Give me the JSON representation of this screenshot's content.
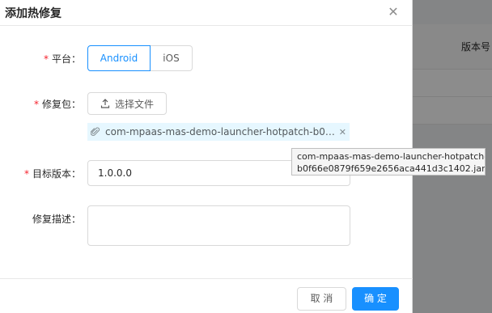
{
  "modal": {
    "title": "添加热修复",
    "close_icon": "close-icon"
  },
  "background": {
    "column_title": "版本号"
  },
  "form": {
    "platform": {
      "label": "平台",
      "required": true,
      "options": [
        "Android",
        "iOS"
      ],
      "selected": "Android"
    },
    "package": {
      "label": "修复包",
      "required": true,
      "upload_button_label": "选择文件",
      "upload_icon": "upload-icon",
      "file_name": "com-mpaas-mas-demo-launcher-hotpatch-b0f66e0879f659e2656aca441d3c1402.jar",
      "file_name_display": "com-mpaas-mas-demo-launcher-hotpatch-b0f66...",
      "file_icon": "paperclip-icon",
      "remove_icon": "close-icon"
    },
    "target_version": {
      "label": "目标版本",
      "required": true,
      "value": "1.0.0.0"
    },
    "description": {
      "label": "修复描述",
      "required": false,
      "value": ""
    }
  },
  "tooltip": {
    "line1": "com-mpaas-mas-demo-launcher-hotpatch-",
    "line2": "b0f66e0879f659e2656aca441d3c1402.jar"
  },
  "footer": {
    "cancel_label": "取 消",
    "ok_label": "确 定"
  },
  "colors": {
    "primary": "#1890ff",
    "required": "#f5222d",
    "file_bg": "#e6f7ff"
  }
}
